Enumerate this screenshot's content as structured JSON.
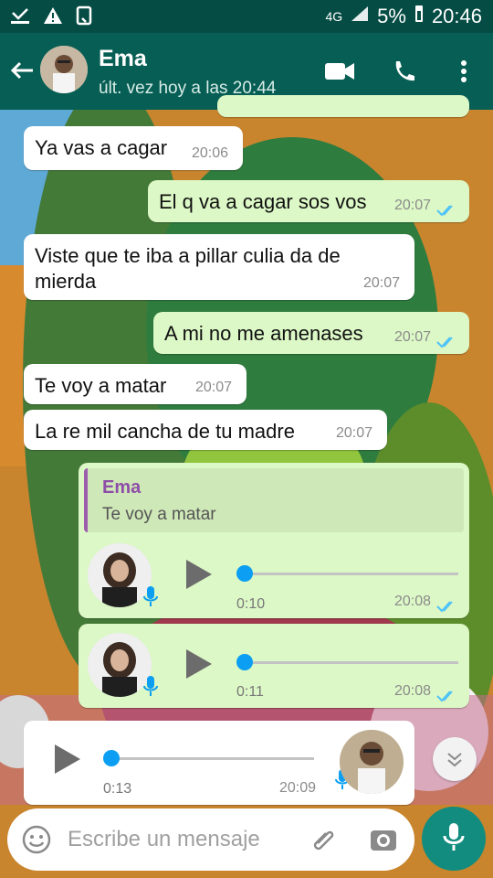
{
  "status_bar": {
    "network": "4G",
    "battery": "5%",
    "time": "20:46",
    "icons": [
      "download-icon",
      "warning-icon",
      "nfc-icon",
      "signal-icon",
      "battery-icon"
    ]
  },
  "header": {
    "contact_name": "Ema",
    "last_seen": "últ. vez hoy a las 20:44",
    "icons": [
      "back-icon",
      "video-call-icon",
      "phone-icon",
      "more-icon"
    ]
  },
  "messages": [
    {
      "type": "incoming",
      "text": "Ya vas a cagar",
      "time": "20:06"
    },
    {
      "type": "outgoing",
      "text": "El q va a cagar sos vos",
      "time": "20:07",
      "status": "read"
    },
    {
      "type": "incoming",
      "text_line1": "Viste que te iba a pillar culia da de",
      "text_line2": "mierda",
      "time": "20:07"
    },
    {
      "type": "outgoing",
      "text": "A mi no me amenases",
      "time": "20:07",
      "status": "read"
    },
    {
      "type": "incoming",
      "text": "Te voy a matar",
      "time": "20:07"
    },
    {
      "type": "incoming",
      "text": "La re mil cancha de tu madre",
      "time": "20:07"
    },
    {
      "type": "outgoing-voice",
      "quote_name": "Ema",
      "quote_text": "Te voy a matar",
      "duration": "0:10",
      "time": "20:08",
      "status": "read"
    },
    {
      "type": "outgoing-voice",
      "duration": "0:11",
      "time": "20:08",
      "status": "read"
    },
    {
      "type": "incoming-voice",
      "duration": "0:13",
      "time": "20:09"
    }
  ],
  "composer": {
    "placeholder": "Escribe un mensaje",
    "icons": [
      "emoji-icon",
      "attach-icon",
      "camera-icon",
      "mic-icon"
    ]
  },
  "colors": {
    "status_bar": "#054d44",
    "app_bar": "#075e54",
    "incoming_bubble": "#ffffff",
    "outgoing_bubble": "#dcf8c6",
    "accent": "#128c7e",
    "read_ticks": "#4fc3f7"
  }
}
